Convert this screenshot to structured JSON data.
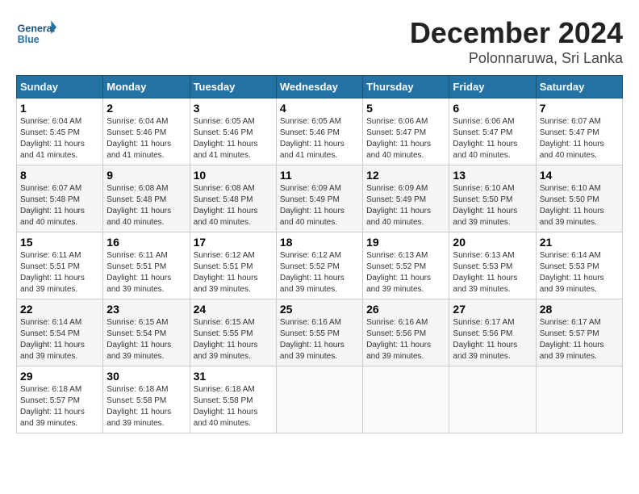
{
  "header": {
    "logo_text_general": "General",
    "logo_text_blue": "Blue",
    "month_title": "December 2024",
    "location": "Polonnaruwa, Sri Lanka"
  },
  "days_of_week": [
    "Sunday",
    "Monday",
    "Tuesday",
    "Wednesday",
    "Thursday",
    "Friday",
    "Saturday"
  ],
  "weeks": [
    [
      {
        "day": "1",
        "sunrise": "6:04 AM",
        "sunset": "5:45 PM",
        "daylight": "11 hours and 41 minutes."
      },
      {
        "day": "2",
        "sunrise": "6:04 AM",
        "sunset": "5:46 PM",
        "daylight": "11 hours and 41 minutes."
      },
      {
        "day": "3",
        "sunrise": "6:05 AM",
        "sunset": "5:46 PM",
        "daylight": "11 hours and 41 minutes."
      },
      {
        "day": "4",
        "sunrise": "6:05 AM",
        "sunset": "5:46 PM",
        "daylight": "11 hours and 41 minutes."
      },
      {
        "day": "5",
        "sunrise": "6:06 AM",
        "sunset": "5:47 PM",
        "daylight": "11 hours and 40 minutes."
      },
      {
        "day": "6",
        "sunrise": "6:06 AM",
        "sunset": "5:47 PM",
        "daylight": "11 hours and 40 minutes."
      },
      {
        "day": "7",
        "sunrise": "6:07 AM",
        "sunset": "5:47 PM",
        "daylight": "11 hours and 40 minutes."
      }
    ],
    [
      {
        "day": "8",
        "sunrise": "6:07 AM",
        "sunset": "5:48 PM",
        "daylight": "11 hours and 40 minutes."
      },
      {
        "day": "9",
        "sunrise": "6:08 AM",
        "sunset": "5:48 PM",
        "daylight": "11 hours and 40 minutes."
      },
      {
        "day": "10",
        "sunrise": "6:08 AM",
        "sunset": "5:48 PM",
        "daylight": "11 hours and 40 minutes."
      },
      {
        "day": "11",
        "sunrise": "6:09 AM",
        "sunset": "5:49 PM",
        "daylight": "11 hours and 40 minutes."
      },
      {
        "day": "12",
        "sunrise": "6:09 AM",
        "sunset": "5:49 PM",
        "daylight": "11 hours and 40 minutes."
      },
      {
        "day": "13",
        "sunrise": "6:10 AM",
        "sunset": "5:50 PM",
        "daylight": "11 hours and 39 minutes."
      },
      {
        "day": "14",
        "sunrise": "6:10 AM",
        "sunset": "5:50 PM",
        "daylight": "11 hours and 39 minutes."
      }
    ],
    [
      {
        "day": "15",
        "sunrise": "6:11 AM",
        "sunset": "5:51 PM",
        "daylight": "11 hours and 39 minutes."
      },
      {
        "day": "16",
        "sunrise": "6:11 AM",
        "sunset": "5:51 PM",
        "daylight": "11 hours and 39 minutes."
      },
      {
        "day": "17",
        "sunrise": "6:12 AM",
        "sunset": "5:51 PM",
        "daylight": "11 hours and 39 minutes."
      },
      {
        "day": "18",
        "sunrise": "6:12 AM",
        "sunset": "5:52 PM",
        "daylight": "11 hours and 39 minutes."
      },
      {
        "day": "19",
        "sunrise": "6:13 AM",
        "sunset": "5:52 PM",
        "daylight": "11 hours and 39 minutes."
      },
      {
        "day": "20",
        "sunrise": "6:13 AM",
        "sunset": "5:53 PM",
        "daylight": "11 hours and 39 minutes."
      },
      {
        "day": "21",
        "sunrise": "6:14 AM",
        "sunset": "5:53 PM",
        "daylight": "11 hours and 39 minutes."
      }
    ],
    [
      {
        "day": "22",
        "sunrise": "6:14 AM",
        "sunset": "5:54 PM",
        "daylight": "11 hours and 39 minutes."
      },
      {
        "day": "23",
        "sunrise": "6:15 AM",
        "sunset": "5:54 PM",
        "daylight": "11 hours and 39 minutes."
      },
      {
        "day": "24",
        "sunrise": "6:15 AM",
        "sunset": "5:55 PM",
        "daylight": "11 hours and 39 minutes."
      },
      {
        "day": "25",
        "sunrise": "6:16 AM",
        "sunset": "5:55 PM",
        "daylight": "11 hours and 39 minutes."
      },
      {
        "day": "26",
        "sunrise": "6:16 AM",
        "sunset": "5:56 PM",
        "daylight": "11 hours and 39 minutes."
      },
      {
        "day": "27",
        "sunrise": "6:17 AM",
        "sunset": "5:56 PM",
        "daylight": "11 hours and 39 minutes."
      },
      {
        "day": "28",
        "sunrise": "6:17 AM",
        "sunset": "5:57 PM",
        "daylight": "11 hours and 39 minutes."
      }
    ],
    [
      {
        "day": "29",
        "sunrise": "6:18 AM",
        "sunset": "5:57 PM",
        "daylight": "11 hours and 39 minutes."
      },
      {
        "day": "30",
        "sunrise": "6:18 AM",
        "sunset": "5:58 PM",
        "daylight": "11 hours and 39 minutes."
      },
      {
        "day": "31",
        "sunrise": "6:18 AM",
        "sunset": "5:58 PM",
        "daylight": "11 hours and 40 minutes."
      },
      null,
      null,
      null,
      null
    ]
  ]
}
